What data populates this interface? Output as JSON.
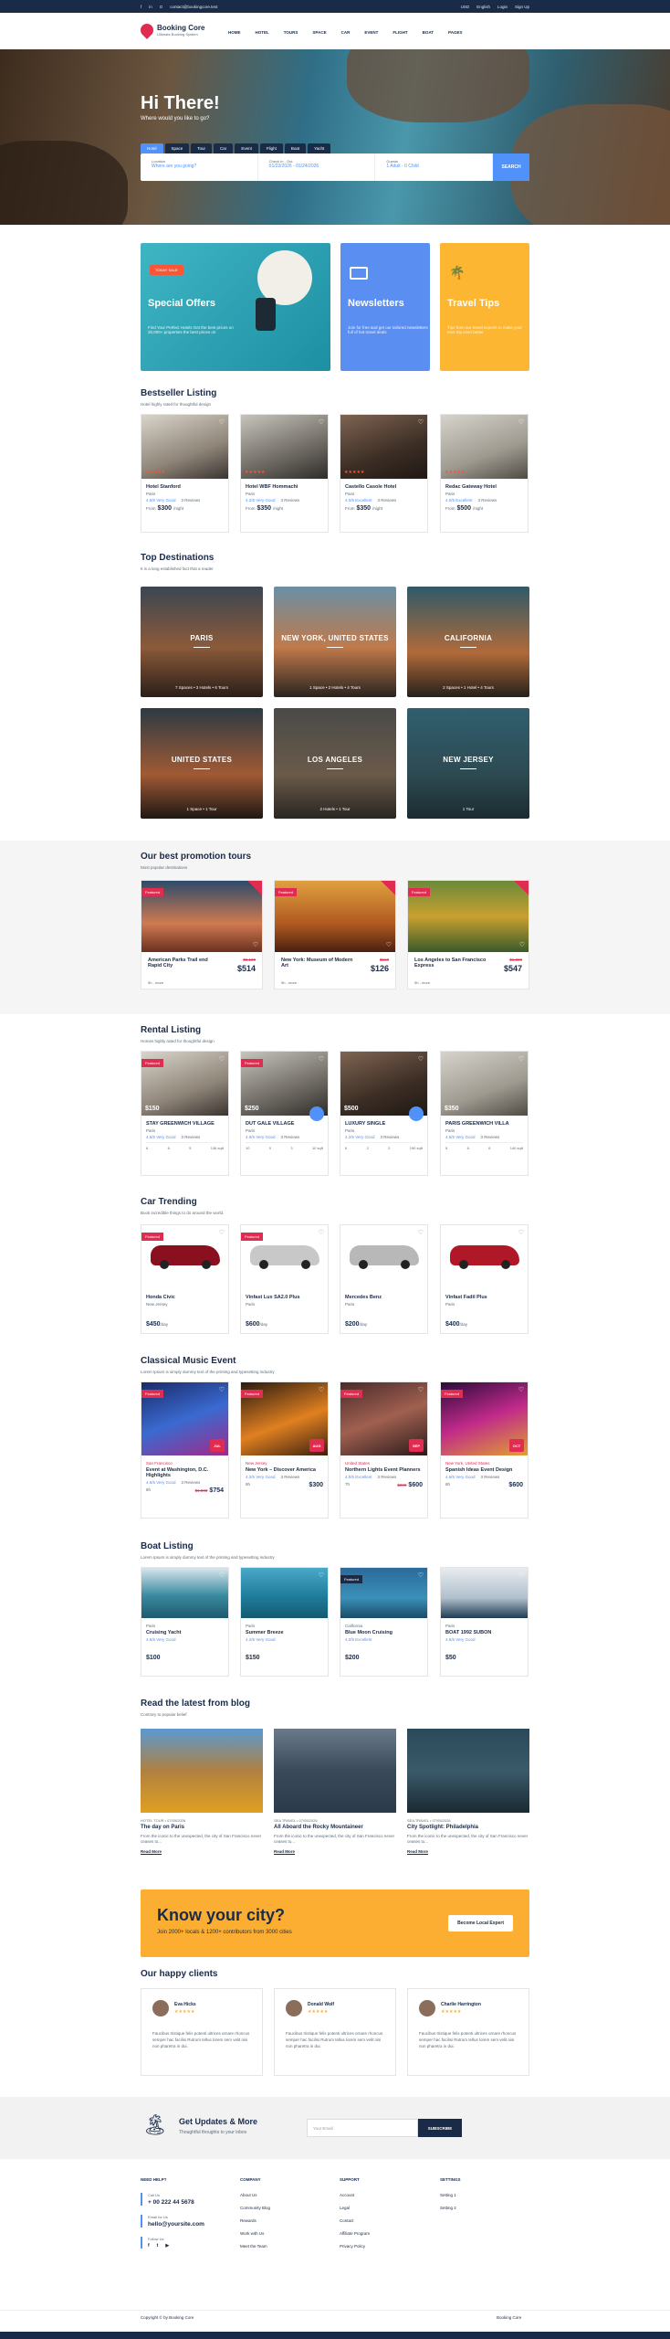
{
  "topbar": {
    "email": "contact@bookingcore.test",
    "currency": "USD",
    "language": "English",
    "login": "Login",
    "signup": "Sign Up"
  },
  "header": {
    "brand": "Booking Core",
    "tagline": "Ultimate Booking System",
    "nav": [
      "HOME",
      "HOTEL",
      "TOURS",
      "SPACE",
      "CAR",
      "EVENT",
      "FLIGHT",
      "BOAT",
      "PAGES"
    ]
  },
  "hero": {
    "title": "Hi There!",
    "subtitle": "Where would you like to go?",
    "tabs": [
      "Hotel",
      "Space",
      "Tour",
      "Car",
      "Event",
      "Flight",
      "Boat",
      "Yacht"
    ],
    "location_label": "Location",
    "location_placeholder": "Where are you going?",
    "dates_label": "Check In - Out",
    "dates_value": "01/23/2026 - 01/24/2026",
    "guests_label": "Guests",
    "guests_value": "1 Adult - 0 Child",
    "search": "SEARCH"
  },
  "promos": [
    {
      "badge": "TODAY SALE",
      "title": "Special Offers",
      "text": "Find Your Perfect Hotels Get the best prices on 20,000+ properties the best prices on"
    },
    {
      "title": "Newsletters",
      "text": "Join for free and get our tailored newsletters full of hot travel deals"
    },
    {
      "title": "Travel Tips",
      "text": "Tips from our travel experts to make your next trip even better"
    }
  ],
  "bestseller": {
    "title": "Bestseller Listing",
    "subtitle": "Hotel highly rated for thoughtful design",
    "items": [
      {
        "name": "Hotel Stanford",
        "loc": "Paris",
        "rating": "4.6/5 Very Good",
        "reviews": "3 Reviews",
        "from": "From",
        "price": "$300",
        "unit": "/night"
      },
      {
        "name": "Hotel WBF Hommachi",
        "loc": "Paris",
        "rating": "4.2/5 Very Good",
        "reviews": "3 Reviews",
        "from": "From",
        "price": "$350",
        "unit": "/night"
      },
      {
        "name": "Castello Casole Hotel",
        "loc": "Paris",
        "rating": "4.0/5 Excellent",
        "reviews": "3 Reviews",
        "from": "From",
        "price": "$350",
        "unit": "/night"
      },
      {
        "name": "Redac Gateway Hotel",
        "loc": "Paris",
        "rating": "4.0/5 Excellent",
        "reviews": "3 Reviews",
        "from": "From",
        "price": "$500",
        "unit": "/night"
      }
    ]
  },
  "destinations": {
    "title": "Top Destinations",
    "subtitle": "It is a long established fact that a reader",
    "items": [
      {
        "name": "PARIS",
        "counts": "7 Spaces  •  3 Hotels  •  6 Tours"
      },
      {
        "name": "NEW YORK, UNITED STATES",
        "counts": "1 Space  •  2 Hotels  •  4 Tours"
      },
      {
        "name": "CALIFORNIA",
        "counts": "2 Spaces  •  1 Hotel  •  4 Tours"
      },
      {
        "name": "UNITED STATES",
        "counts": "1 Space  •  1 Tour"
      },
      {
        "name": "LOS ANGELES",
        "counts": "2 Hotels  •  1 Tour"
      },
      {
        "name": "NEW JERSEY",
        "counts": "1 Tour"
      }
    ]
  },
  "tours": {
    "title": "Our best promotion tours",
    "subtitle": "Most popular destinations",
    "items": [
      {
        "name": "American Parks Trail end Rapid City",
        "old": "$2,100",
        "price": "$514",
        "dur": "5h - more"
      },
      {
        "name": "New York: Museum of Modern Art",
        "old": "$150",
        "price": "$126",
        "dur": "5h - more"
      },
      {
        "name": "Los Angeles to San Francisco Express",
        "old": "$1,000",
        "price": "$547",
        "dur": "5h - more"
      }
    ]
  },
  "rental": {
    "title": "Rental Listing",
    "subtitle": "Homes highly rated for thoughtful design",
    "items": [
      {
        "name": "STAY GREENWICH VILLAGE",
        "loc": "Paris",
        "rating": "4.6/5 Very Good",
        "reviews": "3 Reviews",
        "price": "$150",
        "feat": "Featured",
        "amen": [
          "6",
          "6",
          "5",
          "136 sqft"
        ]
      },
      {
        "name": "DUT GALE VILLAGE",
        "loc": "Paris",
        "rating": "4.6/5 Very Good",
        "reviews": "3 Reviews",
        "price": "$250",
        "feat": "Featured",
        "amen": [
          "10",
          "9",
          "3",
          "10 sqft"
        ]
      },
      {
        "name": "LUXURY SINGLE",
        "loc": "Paris",
        "rating": "4.2/5 Very Good",
        "reviews": "3 Reviews",
        "price": "$500",
        "feat": "",
        "amen": [
          "6",
          "2",
          "2",
          "190 sqft"
        ]
      },
      {
        "name": "PARIS GREENWICH VILLA",
        "loc": "Paris",
        "rating": "4.6/5 Very Good",
        "reviews": "3 Reviews",
        "price": "$350",
        "feat": "",
        "amen": [
          "5",
          "6",
          "6",
          "140 sqft"
        ]
      }
    ]
  },
  "cars": {
    "title": "Car Trending",
    "subtitle": "Book incredible things to do around the world.",
    "items": [
      {
        "name": "Honda Civic",
        "loc": "New Jersey",
        "price": "$450",
        "unit": "/day",
        "feat": "Featured"
      },
      {
        "name": "Vinfast Lux SA2.0 Plus",
        "loc": "Paris",
        "price": "$600",
        "unit": "/day",
        "feat": "Featured"
      },
      {
        "name": "Mercedes Benz",
        "loc": "Paris",
        "price": "$200",
        "unit": "/day",
        "feat": ""
      },
      {
        "name": "Vinfast Fadil Plus",
        "loc": "Paris",
        "price": "$400",
        "unit": "/day",
        "feat": ""
      }
    ]
  },
  "events": {
    "title": "Classical Music Event",
    "subtitle": "Lorem Ipsum is simply dummy text of the printing and typesetting industry",
    "items": [
      {
        "loc": "San Francisco",
        "name": "Event at Washington, D.C. Highlights",
        "rating": "4.6/5 Very Good",
        "reviews": "3 Reviews",
        "dur": "8h",
        "old": "$1,000",
        "price": "$754",
        "date": "JUL"
      },
      {
        "loc": "New Jersey",
        "name": "New York – Discover America",
        "rating": "4.2/5 Very Good",
        "reviews": "3 Reviews",
        "dur": "9h",
        "old": "",
        "price": "$300",
        "date": "AUG"
      },
      {
        "loc": "United States",
        "name": "Northern Lights Event Planners",
        "rating": "4.0/5 Excellent",
        "reviews": "3 Reviews",
        "dur": "7h",
        "old": "$800",
        "price": "$600",
        "date": "SEP"
      },
      {
        "loc": "New York, United States",
        "name": "Spanish Ideas Event Design",
        "rating": "4.6/5 Very Good",
        "reviews": "3 Reviews",
        "dur": "8h",
        "old": "",
        "price": "$600",
        "date": "OCT"
      }
    ]
  },
  "boats": {
    "title": "Boat Listing",
    "subtitle": "Lorem Ipsum is simply dummy text of the printing and typesetting industry",
    "items": [
      {
        "loc": "Paris",
        "name": "Cruising Yacht",
        "rating": "4.6/5 Very Good",
        "price": "$100",
        "feat": ""
      },
      {
        "loc": "Paris",
        "name": "Summer Breeze",
        "rating": "4.2/5 Very Good",
        "price": "$150",
        "feat": ""
      },
      {
        "loc": "California",
        "name": "Blue Moon Cruising",
        "rating": "4.0/5 Excellent",
        "price": "$200",
        "feat": "Featured"
      },
      {
        "loc": "Paris",
        "name": "BOAT 1992 SUBON",
        "rating": "4.6/5 Very Good",
        "price": "$50",
        "feat": ""
      }
    ]
  },
  "blog": {
    "title": "Read the latest from blog",
    "subtitle": "Contrary to popular belief",
    "items": [
      {
        "meta": "HOTEL TOUR  •  07/05/2026",
        "title": "The day on Paris",
        "desc": "From the iconic to the unexpected, the city of San Francisco never ceases to...",
        "more": "Read More"
      },
      {
        "meta": "SEA TRAVEL  •  07/05/2026",
        "title": "All Aboard the Rocky Mountaineer",
        "desc": "From the iconic to the unexpected, the city of San Francisco never ceases to...",
        "more": "Read More"
      },
      {
        "meta": "SEA TRAVEL  •  07/05/2026",
        "title": "City Spotlight: Philadelphia",
        "desc": "From the iconic to the unexpected, the city of San Francisco never ceases to...",
        "more": "Read More"
      }
    ]
  },
  "cta": {
    "title": "Know your city?",
    "text": "Join 2000+ locals & 1200+ contributors from 3000 cities",
    "button": "Become Local Expert"
  },
  "clients": {
    "title": "Our happy clients",
    "items": [
      {
        "name": "Eva Hicks",
        "quote": "Faucibus tristique felis potenti ultrices ornare rhoncus semper hac facilisi Rutrum tellus lorem sem velit nisi non pharetra in dui."
      },
      {
        "name": "Donald Wolf",
        "quote": "Faucibus tristique felis potenti ultrices ornare rhoncus semper hac facilisi Rutrum tellus lorem sem velit nisi non pharetra in dui."
      },
      {
        "name": "Charlie Harrington",
        "quote": "Faucibus tristique felis potenti ultrices ornare rhoncus semper hac facilisi Rutrum tellus lorem sem velit nisi non pharetra in dui."
      }
    ]
  },
  "newsletter": {
    "title": "Get Updates & More",
    "subtitle": "Thoughtful thoughts to your inbox",
    "placeholder": "Your Email",
    "button": "SUBSCRIBE"
  },
  "footer": {
    "help": "NEED HELP?",
    "call_label": "Call Us",
    "phone": "+ 00 222 44 5678",
    "email_label": "Email for Us",
    "email": "hello@yoursite.com",
    "follow_label": "Follow Us",
    "company": {
      "title": "COMPANY",
      "items": [
        "About Us",
        "Community Blog",
        "Rewards",
        "Work with Us",
        "Meet the Team"
      ]
    },
    "support": {
      "title": "SUPPORT",
      "items": [
        "Account",
        "Legal",
        "Contact",
        "Affiliate Program",
        "Privacy Policy"
      ]
    },
    "settings": {
      "title": "SETTINGS",
      "items": [
        "Setting 1",
        "Setting 2"
      ]
    },
    "copyright": "Copyright © by Booking Core",
    "brand": "Booking Core"
  }
}
